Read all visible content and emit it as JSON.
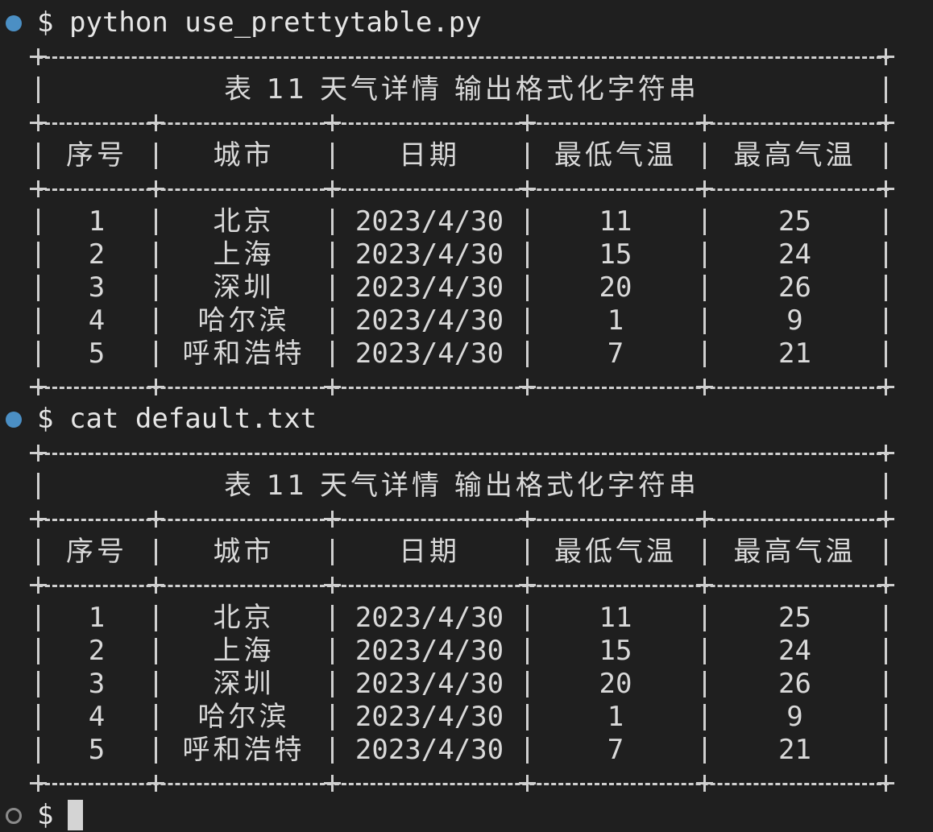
{
  "terminal": {
    "prompt_symbol": "$",
    "commands": [
      "python use_prettytable.py",
      "cat default.txt"
    ]
  },
  "table": {
    "title": "表 11 天气详情 输出格式化字符串",
    "headers": [
      "序号",
      "城市",
      "日期",
      "最低气温",
      "最高气温"
    ],
    "rows": [
      [
        "1",
        "北京",
        "2023/4/30",
        "11",
        "25"
      ],
      [
        "2",
        "上海",
        "2023/4/30",
        "15",
        "24"
      ],
      [
        "3",
        "深圳",
        "2023/4/30",
        "20",
        "26"
      ],
      [
        "4",
        "哈尔滨",
        "2023/4/30",
        "1",
        "9"
      ],
      [
        "5",
        "呼和浩特",
        "2023/4/30",
        "7",
        "21"
      ]
    ]
  },
  "colors": {
    "background": "#1f1f1f",
    "text": "#d4d4d4",
    "status_dot_success": "#4b8fc4",
    "status_dot_idle": "#8a8a8a"
  }
}
